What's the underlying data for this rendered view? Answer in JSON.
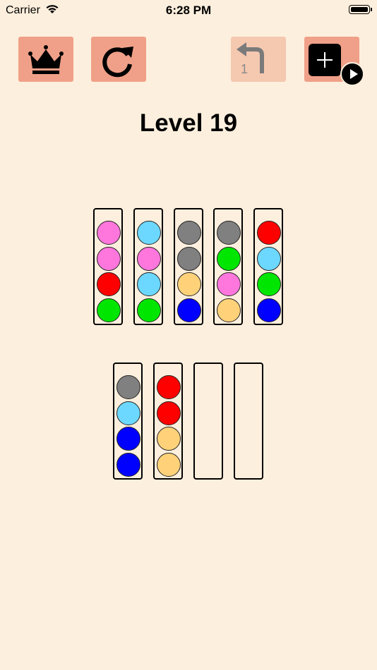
{
  "status": {
    "carrier": "Carrier",
    "time": "6:28 PM"
  },
  "toolbar": {
    "crown_icon": "crown-icon",
    "restart_icon": "restart-icon",
    "undo_icon": "undo-arrow-icon",
    "undo_count": "1",
    "add_tube_icon": "plus-icon",
    "video_icon": "play-icon"
  },
  "level": {
    "title": "Level 19"
  },
  "colors": {
    "pink": "#ff77dd",
    "cyan": "#6dd8ff",
    "red": "#ff0000",
    "green": "#00e600",
    "gray": "#808080",
    "yellow": "#ffd27a",
    "blue": "#0000ff"
  },
  "tubes": [
    {
      "balls_top_to_bottom": [
        "pink",
        "pink",
        "red",
        "green"
      ]
    },
    {
      "balls_top_to_bottom": [
        "cyan",
        "pink",
        "cyan",
        "green"
      ]
    },
    {
      "balls_top_to_bottom": [
        "gray",
        "gray",
        "yellow",
        "blue"
      ]
    },
    {
      "balls_top_to_bottom": [
        "gray",
        "green",
        "pink",
        "yellow"
      ]
    },
    {
      "balls_top_to_bottom": [
        "red",
        "cyan",
        "green",
        "blue"
      ]
    },
    {
      "balls_top_to_bottom": [
        "gray",
        "cyan",
        "blue",
        "blue"
      ]
    },
    {
      "balls_top_to_bottom": [
        "red",
        "red",
        "yellow",
        "yellow"
      ]
    },
    {
      "balls_top_to_bottom": []
    },
    {
      "balls_top_to_bottom": []
    }
  ]
}
